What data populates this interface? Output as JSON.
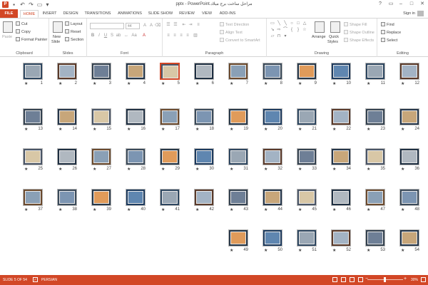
{
  "titlebar": {
    "app_icon_text": "P",
    "title": "مراحل ساخت برج میلاد.pptx - PowerPoint",
    "qat": [
      "save-icon",
      "undo-icon",
      "redo-icon",
      "start-from-beginning-icon",
      "customize-qat-icon"
    ],
    "help": "?",
    "minimize": "–",
    "restore": "□",
    "close": "✕"
  },
  "tabs": [
    {
      "label": "FILE"
    },
    {
      "label": "HOME"
    },
    {
      "label": "INSERT"
    },
    {
      "label": "DESIGN"
    },
    {
      "label": "TRANSITIONS"
    },
    {
      "label": "ANIMATIONS"
    },
    {
      "label": "SLIDE SHOW"
    },
    {
      "label": "REVIEW"
    },
    {
      "label": "VIEW"
    },
    {
      "label": "ADD-INS"
    }
  ],
  "active_tab": "HOME",
  "signin": "Sign in",
  "ribbon": {
    "clipboard": {
      "label": "Clipboard",
      "paste": "Paste",
      "cut": "Cut",
      "copy": "Copy",
      "format_painter": "Format Painter"
    },
    "slides": {
      "label": "Slides",
      "new_slide_1": "New",
      "new_slide_2": "Slide",
      "layout": "Layout",
      "reset": "Reset",
      "section": "Section"
    },
    "font": {
      "label": "Font",
      "size_value": "44"
    },
    "paragraph": {
      "label": "Paragraph",
      "text_direction": "Text Direction",
      "align_text": "Align Text",
      "convert_smartart": "Convert to SmartArt"
    },
    "drawing": {
      "label": "Drawing",
      "arrange": "Arrange",
      "quick_styles_1": "Quick",
      "quick_styles_2": "Styles",
      "shape_fill": "Shape Fill",
      "shape_outline": "Shape Outline",
      "shape_effects": "Shape Effects"
    },
    "editing": {
      "label": "Editing",
      "find": "Find",
      "replace": "Replace",
      "select": "Select"
    }
  },
  "slides": {
    "selected": 5,
    "star": "★",
    "items": [
      {
        "number": "12"
      },
      {
        "number": "11"
      },
      {
        "number": "10"
      },
      {
        "number": "9"
      },
      {
        "number": "8"
      },
      {
        "number": "7"
      },
      {
        "number": "6"
      },
      {
        "number": "5"
      },
      {
        "number": "4"
      },
      {
        "number": "3"
      },
      {
        "number": "2"
      },
      {
        "number": "1"
      },
      {
        "number": "24"
      },
      {
        "number": "23"
      },
      {
        "number": "22"
      },
      {
        "number": "21"
      },
      {
        "number": "20"
      },
      {
        "number": "19"
      },
      {
        "number": "18"
      },
      {
        "number": "17"
      },
      {
        "number": "16"
      },
      {
        "number": "15"
      },
      {
        "number": "14"
      },
      {
        "number": "13"
      },
      {
        "number": "36"
      },
      {
        "number": "35"
      },
      {
        "number": "34"
      },
      {
        "number": "33"
      },
      {
        "number": "32"
      },
      {
        "number": "31"
      },
      {
        "number": "30"
      },
      {
        "number": "29"
      },
      {
        "number": "28"
      },
      {
        "number": "27"
      },
      {
        "number": "26"
      },
      {
        "number": "25"
      },
      {
        "number": "48"
      },
      {
        "number": "47"
      },
      {
        "number": "46"
      },
      {
        "number": "45"
      },
      {
        "number": "44"
      },
      {
        "number": "43"
      },
      {
        "number": "42"
      },
      {
        "number": "41"
      },
      {
        "number": "40"
      },
      {
        "number": "39"
      },
      {
        "number": "38"
      },
      {
        "number": "37"
      },
      {
        "number": "54"
      },
      {
        "number": "53"
      },
      {
        "number": "52"
      },
      {
        "number": "51"
      },
      {
        "number": "50"
      },
      {
        "number": "49"
      }
    ]
  },
  "statusbar": {
    "slide_info": "SLIDE 5 OF 54",
    "language": "PERSIAN",
    "zoom": "30%",
    "zoom_minus": "−",
    "zoom_plus": "+"
  },
  "colors": {
    "accent": "#d24726",
    "selected_border": "#d24726"
  }
}
